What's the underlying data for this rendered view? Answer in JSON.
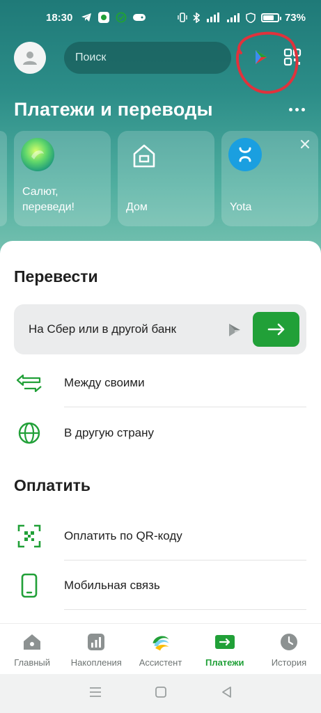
{
  "status_bar": {
    "time": "18:30",
    "battery": "73%"
  },
  "header": {
    "search_placeholder": "Поиск"
  },
  "payments": {
    "title": "Платежи и переводы",
    "tiles": [
      {
        "label": "Салют, переведи!"
      },
      {
        "label": "Дом"
      },
      {
        "label": "Yota"
      }
    ]
  },
  "transfer": {
    "title": "Перевести",
    "card_label": "На Сбер или в другой банк",
    "items": [
      {
        "label": "Между своими",
        "icon": "arrows-icon"
      },
      {
        "label": "В другую страну",
        "icon": "globe-icon"
      }
    ]
  },
  "pay": {
    "title": "Оплатить",
    "items": [
      {
        "label": "Оплатить по QR-коду",
        "icon": "qr-scan-icon"
      },
      {
        "label": "Мобильная связь",
        "icon": "phone-icon"
      }
    ]
  },
  "nav": [
    {
      "label": "Главный",
      "icon": "home-icon"
    },
    {
      "label": "Накопления",
      "icon": "chart-icon"
    },
    {
      "label": "Ассистент",
      "icon": "sber-assistant-icon"
    },
    {
      "label": "Платежи",
      "icon": "payments-icon",
      "active": true
    },
    {
      "label": "История",
      "icon": "clock-icon"
    }
  ],
  "colors": {
    "accent": "#21a038",
    "header_top": "#1f7a78",
    "header_bottom": "#7cc4b3",
    "annotation": "#e0323c"
  }
}
